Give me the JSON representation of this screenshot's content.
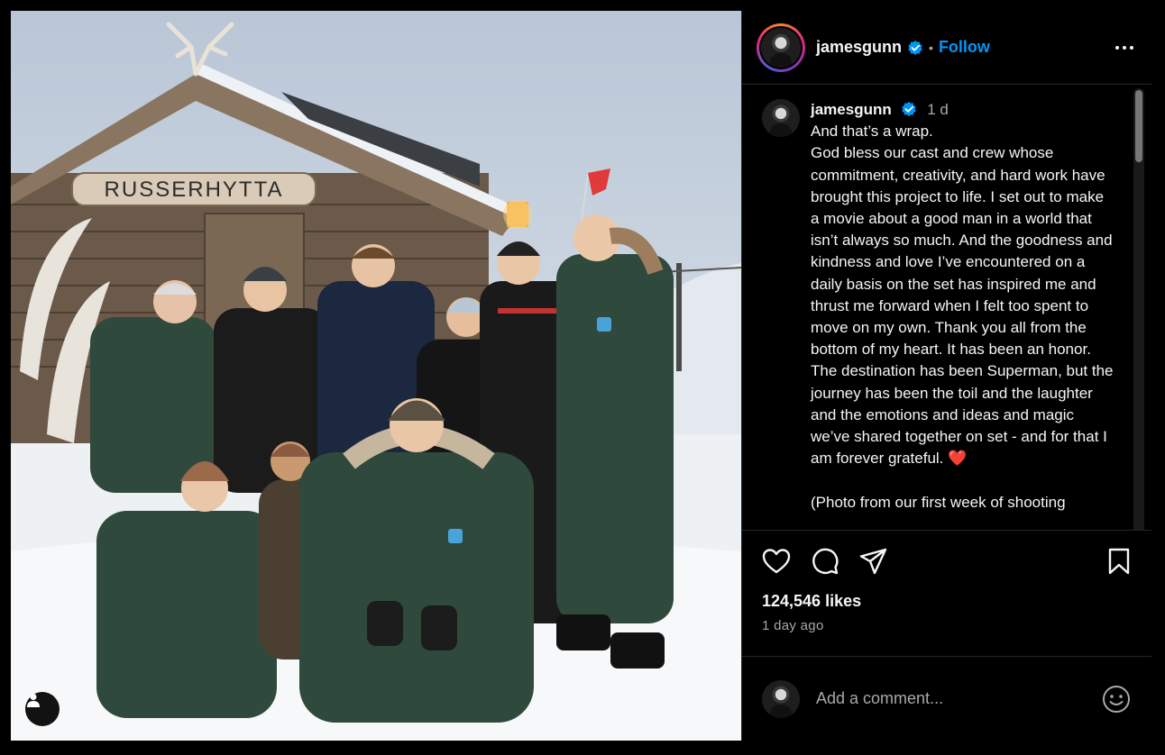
{
  "post": {
    "photo_alt": "Cast and crew photo in front of a snowy cabin",
    "cabin_sign": "RUSSERHYTTA",
    "user_tag_icon": "person-icon"
  },
  "header": {
    "username": "jamesgunn",
    "separator": "•",
    "follow_label": "Follow"
  },
  "caption": {
    "username": "jamesgunn",
    "age": "1 d",
    "text": "And that’s a wrap.\nGod bless our cast and crew whose commitment, creativity, and hard work have brought this project to life. I set out to make a movie about a good man in a world that isn’t always so much. And the goodness and kindness and love I’ve encountered on a daily basis on the set has inspired me and thrust me forward when I felt too spent to move on my own. Thank you all from the bottom of my heart. It has been an honor. The destination has been Superman, but the journey has been the toil and the laughter and the emotions and ideas and magic we’ve shared together on set - and for that I am forever grateful. ❤️\n\n(Photo from our first week of shooting"
  },
  "actions": {
    "like_icon": "heart-icon",
    "comment_icon": "comment-icon",
    "share_icon": "share-icon",
    "save_icon": "bookmark-icon",
    "likes": "124,546 likes",
    "timestamp": "1 day ago"
  },
  "comment": {
    "placeholder": "Add a comment..."
  },
  "colors": {
    "accent": "#0095f6",
    "background": "#000000",
    "secondary_text": "#a8a8a8",
    "divider": "#262626"
  }
}
